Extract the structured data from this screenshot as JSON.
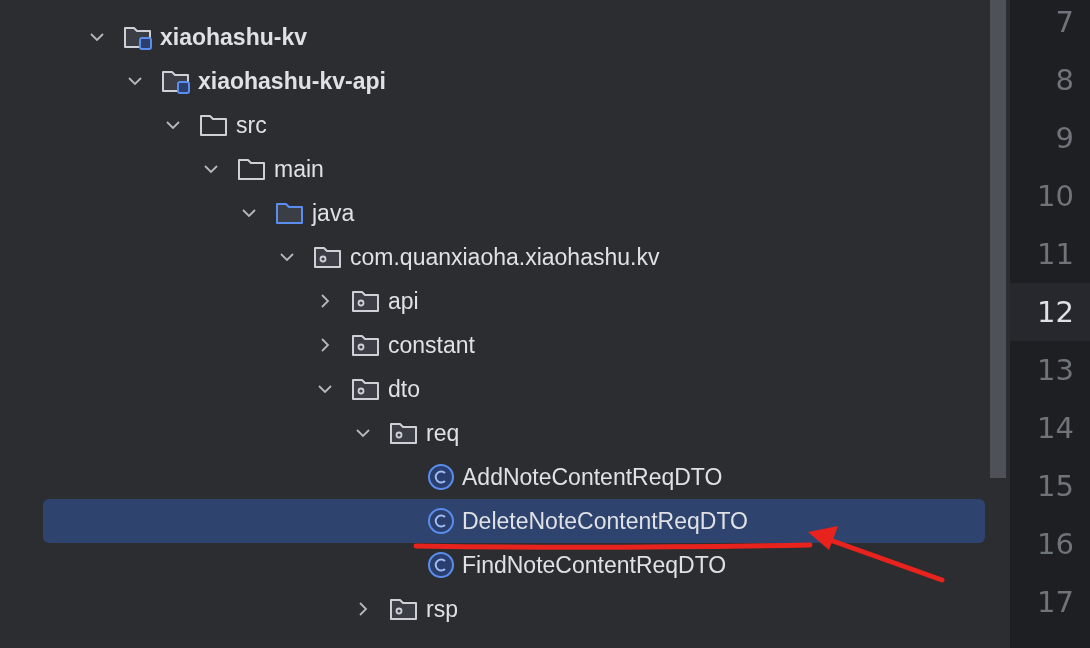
{
  "project_tree": {
    "items": [
      {
        "kind": "module",
        "label": "xiaohashu-kv",
        "expanded": true,
        "selected": false,
        "children": [
          {
            "kind": "module",
            "label": "xiaohashu-kv-api",
            "expanded": true,
            "selected": false,
            "children": [
              {
                "kind": "folder",
                "label": "src",
                "expanded": true,
                "selected": false,
                "children": [
                  {
                    "kind": "folder",
                    "label": "main",
                    "expanded": true,
                    "selected": false,
                    "children": [
                      {
                        "kind": "source",
                        "label": "java",
                        "expanded": true,
                        "selected": false,
                        "children": [
                          {
                            "kind": "package",
                            "label": "com.quanxiaoha.xiaohashu.kv",
                            "expanded": true,
                            "selected": false,
                            "children": [
                              {
                                "kind": "package",
                                "label": "api",
                                "expanded": false,
                                "selected": false
                              },
                              {
                                "kind": "package",
                                "label": "constant",
                                "expanded": false,
                                "selected": false
                              },
                              {
                                "kind": "package",
                                "label": "dto",
                                "expanded": true,
                                "selected": false,
                                "children": [
                                  {
                                    "kind": "package",
                                    "label": "req",
                                    "expanded": true,
                                    "selected": false,
                                    "children": [
                                      {
                                        "kind": "class",
                                        "label": "AddNoteContentReqDTO",
                                        "selected": false
                                      },
                                      {
                                        "kind": "class",
                                        "label": "DeleteNoteContentReqDTO",
                                        "selected": true
                                      },
                                      {
                                        "kind": "class",
                                        "label": "FindNoteContentReqDTO",
                                        "selected": false
                                      }
                                    ]
                                  },
                                  {
                                    "kind": "package",
                                    "label": "rsp",
                                    "expanded": false,
                                    "selected": false
                                  }
                                ]
                              }
                            ]
                          }
                        ]
                      }
                    ]
                  }
                ]
              }
            ]
          }
        ]
      }
    ]
  },
  "gutter": {
    "line_numbers": [
      {
        "text": "7",
        "current": false
      },
      {
        "text": "8",
        "current": false
      },
      {
        "text": "9",
        "current": false
      },
      {
        "text": "10",
        "current": false
      },
      {
        "text": "11",
        "current": false
      },
      {
        "text": "12",
        "current": true
      },
      {
        "text": "13",
        "current": false
      },
      {
        "text": "14",
        "current": false
      },
      {
        "text": "15",
        "current": false
      },
      {
        "text": "16",
        "current": false
      },
      {
        "text": "17",
        "current": false
      }
    ]
  }
}
